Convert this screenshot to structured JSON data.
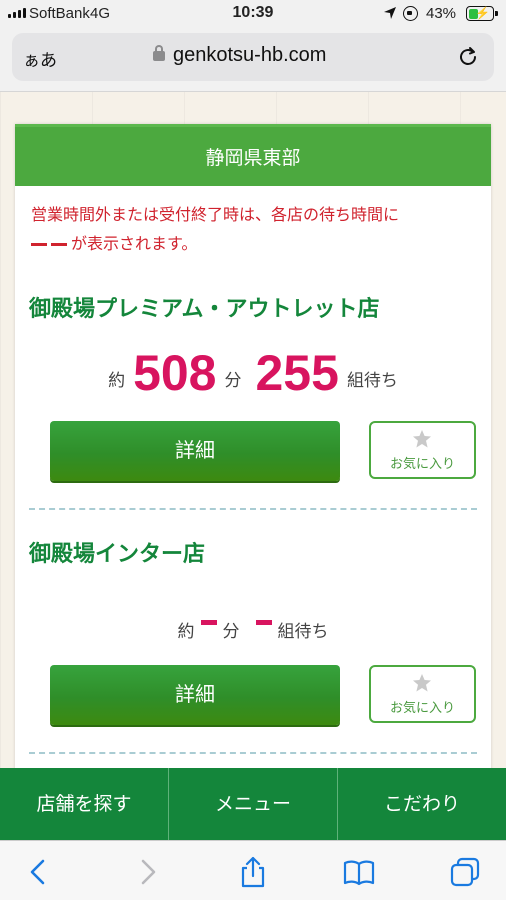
{
  "status_bar": {
    "carrier": "SoftBank",
    "network": "4G",
    "time": "10:39",
    "battery_percent": "43%",
    "battery_level": 0.43
  },
  "browser": {
    "aa_label": "ぁあ",
    "url": "genkotsu-hb.com"
  },
  "region": {
    "title": "静岡県東部"
  },
  "notice": {
    "line1": "営業時間外または受付終了時は、各店の待ち時間に",
    "line2": "が表示されます。"
  },
  "stores": [
    {
      "name": "御殿場プレミアム・アウトレット店",
      "about": "約",
      "minutes": "508",
      "minutes_unit": "分",
      "groups": "255",
      "groups_unit": "組待ち",
      "detail_label": "詳細",
      "favorite_label": "お気に入り"
    },
    {
      "name": "御殿場インター店",
      "about": "約",
      "minutes_unit": "分",
      "groups_unit": "組待ち",
      "detail_label": "詳細",
      "favorite_label": "お気に入り"
    }
  ],
  "bottom_nav": [
    "店舗を探す",
    "メニュー",
    "こだわり"
  ],
  "colors": {
    "brand_green": "#14863b",
    "header_green": "#4ca93f",
    "wait_pink": "#d8145f",
    "notice_red": "#d0232e"
  }
}
